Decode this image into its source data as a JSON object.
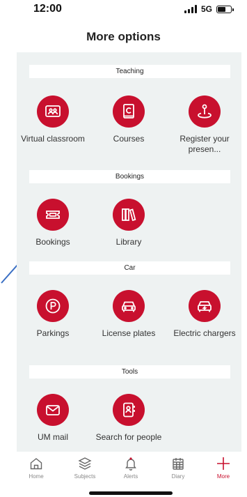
{
  "status_bar": {
    "time": "12:00",
    "network": "5G"
  },
  "page_title": "More options",
  "sections": [
    {
      "header": "Teaching",
      "items": [
        {
          "label": "Virtual classroom",
          "icon": "virtual-classroom-icon"
        },
        {
          "label": "Courses",
          "icon": "courses-icon"
        },
        {
          "label": "Register your presen...",
          "icon": "register-presence-icon"
        }
      ]
    },
    {
      "header": "Bookings",
      "items": [
        {
          "label": "Bookings",
          "icon": "ticket-icon"
        },
        {
          "label": "Library",
          "icon": "library-books-icon"
        }
      ]
    },
    {
      "header": "Car",
      "items": [
        {
          "label": "Parkings",
          "icon": "parking-icon"
        },
        {
          "label": "License plates",
          "icon": "car-icon"
        },
        {
          "label": "Electric chargers",
          "icon": "electric-charger-icon"
        }
      ]
    },
    {
      "header": "Tools",
      "items": [
        {
          "label": "UM mail",
          "icon": "mail-icon"
        },
        {
          "label": "Search for people",
          "icon": "contacts-search-icon"
        }
      ]
    }
  ],
  "tab_bar": {
    "tabs": [
      {
        "label": "Home",
        "icon": "home-icon"
      },
      {
        "label": "Subjects",
        "icon": "layers-icon"
      },
      {
        "label": "Alerts",
        "icon": "bell-icon"
      },
      {
        "label": "Diary",
        "icon": "calendar-icon"
      },
      {
        "label": "More",
        "icon": "plus-icon",
        "active": true
      }
    ]
  },
  "colors": {
    "accent": "#c8102e",
    "panel_bg": "#eef2f2",
    "tab_inactive": "#888888"
  }
}
